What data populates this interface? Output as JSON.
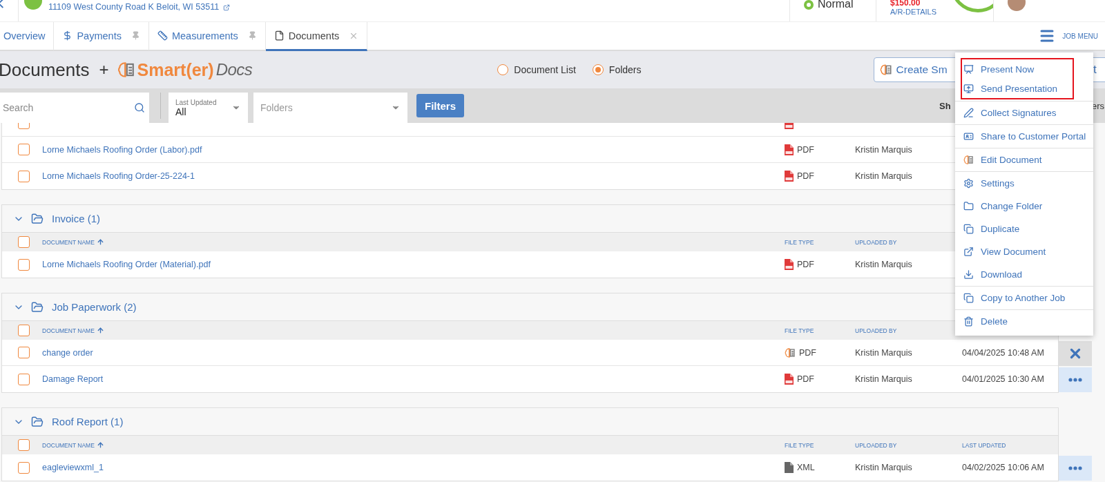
{
  "header": {
    "address": "11109 West County Road K Beloit, WI 53511",
    "status": "Normal",
    "balance": "$150.00",
    "balance_link": "A/R-DETAILS"
  },
  "tabs": [
    {
      "label": "Overview",
      "selected": false
    },
    {
      "label": "Payments",
      "selected": false
    },
    {
      "label": "Measurements",
      "selected": false
    },
    {
      "label": "Documents",
      "selected": true
    }
  ],
  "job_menu": "JOB MENU",
  "page": {
    "title": "Documents",
    "joiner": "+",
    "logo_main": "Smart(er)",
    "logo_docs": "Docs",
    "create_button": "Create Sm",
    "other_button": "t",
    "views": [
      {
        "label": "Document List",
        "selected": false
      },
      {
        "label": "Folders",
        "selected": true
      }
    ]
  },
  "filters": {
    "search_placeholder": "Search",
    "date_label": "Last Updated",
    "date_value": "All",
    "folder_placeholder": "Folders",
    "filter_button": "Filters",
    "show_label": "Sh",
    "trailing_label": "ers"
  },
  "folders": [
    {
      "rows": [
        {
          "kind": "pdf",
          "checked": false
        },
        {
          "name": "Lorne Michaels Roofing Order (Labor).pdf",
          "kind": "pdf",
          "file_type": "PDF",
          "uploaded_by": "Kristin Marquis",
          "checked": false
        },
        {
          "name": "Lorne Michaels Roofing Order-25-224-1",
          "kind": "pdf",
          "file_type": "PDF",
          "uploaded_by": "Kristin Marquis",
          "checked": false
        }
      ]
    },
    {
      "name": "Invoice (1)",
      "columns": {
        "name": "DOCUMENT NAME",
        "file_type": "FILE TYPE",
        "uploaded_by": "UPLOADED BY"
      },
      "all_checked": false,
      "rows": [
        {
          "name": "Lorne Michaels Roofing Order (Material).pdf",
          "kind": "pdf",
          "file_type": "PDF",
          "uploaded_by": "Kristin Marquis",
          "checked": false
        }
      ]
    },
    {
      "name": "Job Paperwork (2)",
      "columns": {
        "name": "DOCUMENT NAME",
        "file_type": "FILE TYPE",
        "uploaded_by": "UPLOADED BY"
      },
      "all_checked": false,
      "rows": [
        {
          "name": "change order",
          "kind": "smart",
          "file_type": "PDF",
          "uploaded_by": "Kristin Marquis",
          "last_updated": "04/04/2025 10:48 AM",
          "action": {
            "kind": "close"
          },
          "checked": false
        },
        {
          "name": "Damage Report",
          "kind": "pdf",
          "file_type": "PDF",
          "uploaded_by": "Kristin Marquis",
          "last_updated": "04/01/2025 10:30 AM",
          "action": {
            "kind": "more"
          },
          "checked": false
        }
      ]
    },
    {
      "name": "Roof Report (1)",
      "columns": {
        "name": "DOCUMENT NAME",
        "file_type": "FILE TYPE",
        "uploaded_by": "UPLOADED BY",
        "last_updated": "LAST UPDATED"
      },
      "all_checked": false,
      "rows": [
        {
          "name": "eagleviewxml_1",
          "kind": "xml",
          "file_type": "XML",
          "uploaded_by": "Kristin Marquis",
          "last_updated": "04/02/2025 10:06 AM",
          "action": {
            "kind": "more"
          },
          "checked": false
        }
      ]
    }
  ],
  "menu": {
    "groups": [
      {
        "highlighted": true,
        "items": [
          "Present Now",
          "Send Presentation"
        ]
      },
      {
        "highlighted": false,
        "items": [
          "Collect Signatures"
        ]
      },
      {
        "highlighted": false,
        "items": [
          "Share to Customer Portal"
        ]
      },
      {
        "highlighted": false,
        "items": [
          "Edit Document"
        ]
      },
      {
        "highlighted": false,
        "items": [
          "Settings",
          "Change Folder",
          "Duplicate",
          "View Document",
          "Download"
        ]
      },
      {
        "highlighted": false,
        "items": [
          "Copy to Another Job"
        ]
      },
      {
        "highlighted": false,
        "items": [
          "Delete"
        ]
      }
    ]
  }
}
